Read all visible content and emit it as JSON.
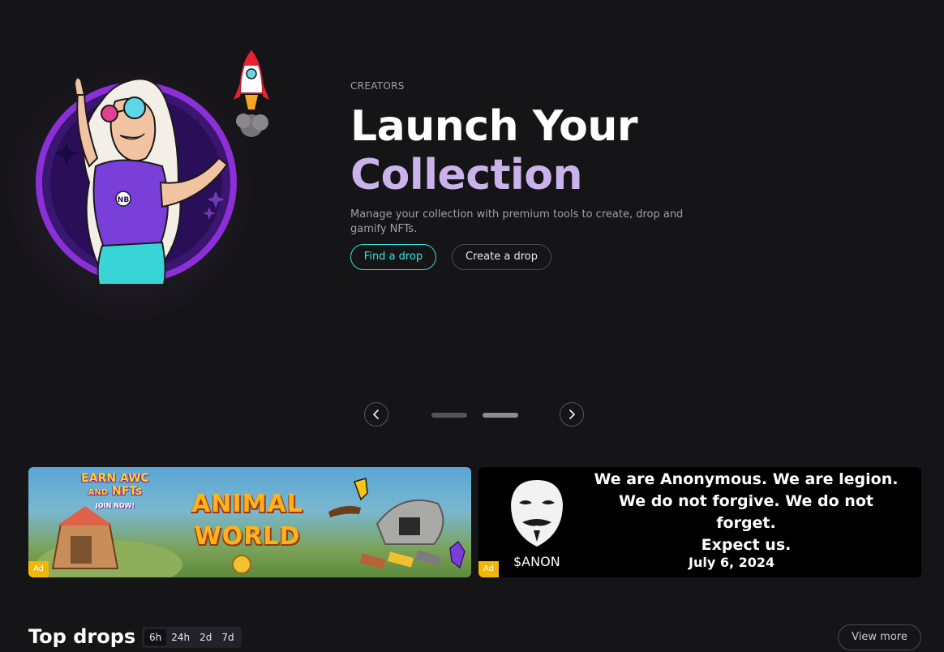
{
  "hero": {
    "eyebrow": "CREATORS",
    "title_line1": "Launch Your",
    "title_line2": "Collection",
    "description": "Manage your collection with premium tools to create, drop and gamify NFTs.",
    "primary_button": "Find a drop",
    "secondary_button": "Create a drop",
    "badge_letters": "NB"
  },
  "carousel": {
    "slide_count": 2,
    "active_slide": 2,
    "prev_icon": "chevron-left-icon",
    "next_icon": "chevron-right-icon"
  },
  "banners": [
    {
      "name": "animal-world",
      "ad_label": "Ad",
      "earn_line1": "EARN AWC",
      "earn_line2": "AND",
      "earn_line3": "NFTs",
      "earn_line4": "JOIN NOW!",
      "title_line1": "ANIMAL",
      "title_line2": "WORLD"
    },
    {
      "name": "anonymous",
      "ad_label": "Ad",
      "line1": "We are Anonymous. We are legion.",
      "line2": "We do not forgive. We do not forget.",
      "line3": "Expect us.",
      "ticker": "$ANON",
      "date": "July 6, 2024"
    }
  ],
  "top_drops": {
    "title": "Top drops",
    "ranges": [
      "6h",
      "24h",
      "2d",
      "7d"
    ],
    "view_more": "View more"
  },
  "colors": {
    "background": "#151417",
    "accent_cyan": "#2ce0d8",
    "title_gradient_lavender": "#c9b3ea",
    "ad_badge": "#f2b705"
  }
}
